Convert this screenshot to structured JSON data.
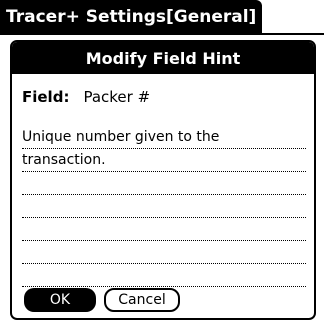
{
  "app": {
    "title": "Tracer+ Settings[General]"
  },
  "dialog": {
    "title": "Modify Field Hint",
    "field_label": "Field:",
    "field_value": "Packer #",
    "hint_lines": [
      "Unique number given to the",
      "transaction.",
      "",
      "",
      "",
      "",
      ""
    ],
    "ok_label": "OK",
    "cancel_label": "Cancel"
  }
}
